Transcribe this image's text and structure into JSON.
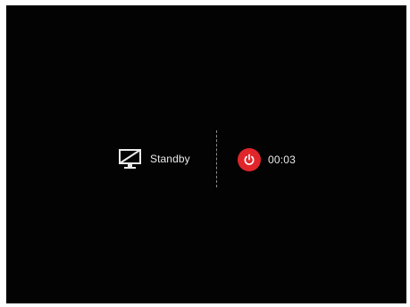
{
  "standby": {
    "label": "Standby",
    "icon": "monitor-off-icon"
  },
  "timer": {
    "value": "00:03",
    "icon": "power-icon"
  },
  "colors": {
    "screen_background": "#030303",
    "accent_red": "#e0262b",
    "text": "#e9e9e9"
  }
}
